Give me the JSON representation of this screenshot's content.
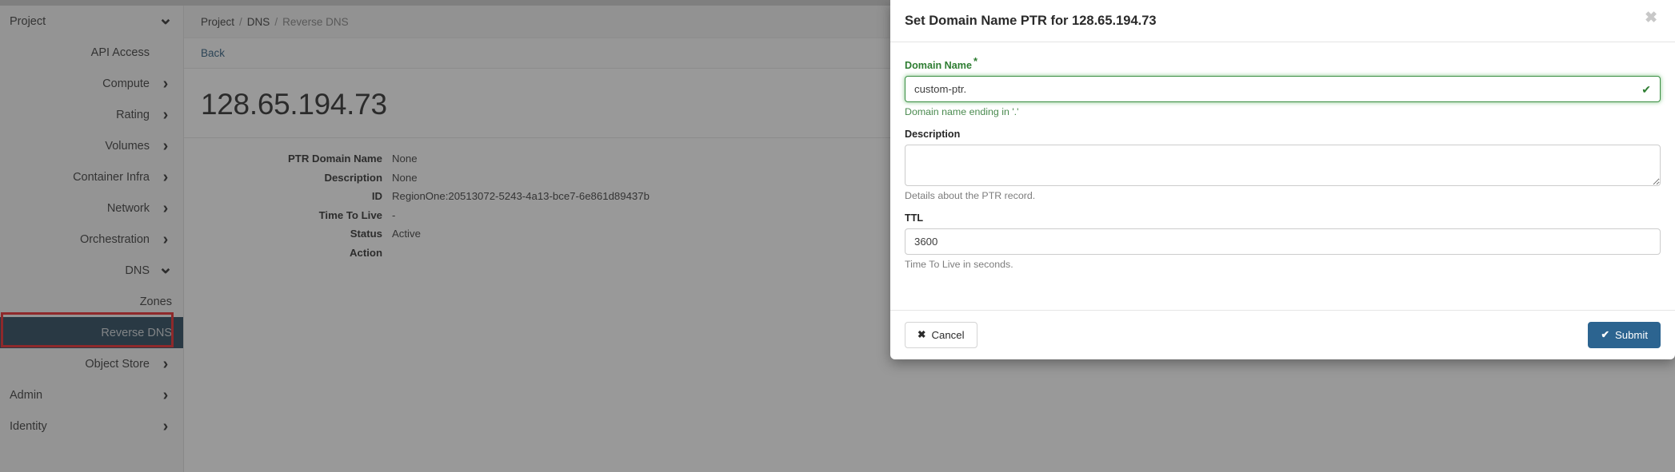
{
  "sidebar": {
    "items": [
      {
        "label": "Project",
        "level": 0,
        "icon": "chevron-down-icon",
        "active": false
      },
      {
        "label": "API Access",
        "level": 1,
        "icon": "",
        "active": false
      },
      {
        "label": "Compute",
        "level": 1,
        "icon": "chevron-right-icon",
        "active": false
      },
      {
        "label": "Rating",
        "level": 1,
        "icon": "chevron-right-icon",
        "active": false
      },
      {
        "label": "Volumes",
        "level": 1,
        "icon": "chevron-right-icon",
        "active": false
      },
      {
        "label": "Container Infra",
        "level": 1,
        "icon": "chevron-right-icon",
        "active": false
      },
      {
        "label": "Network",
        "level": 1,
        "icon": "chevron-right-icon",
        "active": false
      },
      {
        "label": "Orchestration",
        "level": 1,
        "icon": "chevron-right-icon",
        "active": false
      },
      {
        "label": "DNS",
        "level": 1,
        "icon": "chevron-down-icon",
        "active": false
      },
      {
        "label": "Zones",
        "level": 2,
        "icon": "",
        "active": false
      },
      {
        "label": "Reverse DNS",
        "level": 2,
        "icon": "",
        "active": true
      },
      {
        "label": "Object Store",
        "level": 1,
        "icon": "chevron-right-icon",
        "active": false
      },
      {
        "label": "Admin",
        "level": 0,
        "icon": "chevron-right-icon",
        "active": false
      },
      {
        "label": "Identity",
        "level": 0,
        "icon": "chevron-right-icon",
        "active": false
      }
    ],
    "active_highlight_color": "#15374f",
    "annotation_color": "#e8151b"
  },
  "breadcrumb": {
    "items": [
      "Project",
      "DNS",
      "Reverse DNS"
    ],
    "separator": "/"
  },
  "main": {
    "back_label": "Back",
    "page_title": "128.65.194.73",
    "details": [
      {
        "term": "PTR Domain Name",
        "value": "None"
      },
      {
        "term": "Description",
        "value": "None"
      },
      {
        "term": "ID",
        "value": "RegionOne:20513072-5243-4a13-bce7-6e861d89437b"
      },
      {
        "term": "Time To Live",
        "value": "-"
      },
      {
        "term": "Status",
        "value": "Active"
      },
      {
        "term": "Action",
        "value": ""
      }
    ]
  },
  "modal": {
    "title": "Set Domain Name PTR for 128.65.194.73",
    "close_icon": "✖",
    "fields": {
      "domain_name": {
        "label": "Domain Name",
        "required_marker": "*",
        "value": "custom-ptr.",
        "placeholder": "",
        "help": "Domain name ending in '.'",
        "valid_icon": "✔",
        "valid_color": "#2e7d32"
      },
      "description": {
        "label": "Description",
        "value": "",
        "placeholder": "",
        "help": "Details about the PTR record."
      },
      "ttl": {
        "label": "TTL",
        "value": "3600",
        "placeholder": "",
        "help": "Time To Live in seconds."
      }
    },
    "footer": {
      "cancel_label": "Cancel",
      "cancel_icon": "✖",
      "submit_label": "Submit",
      "submit_icon": "✔",
      "submit_color": "#2c6490"
    }
  }
}
